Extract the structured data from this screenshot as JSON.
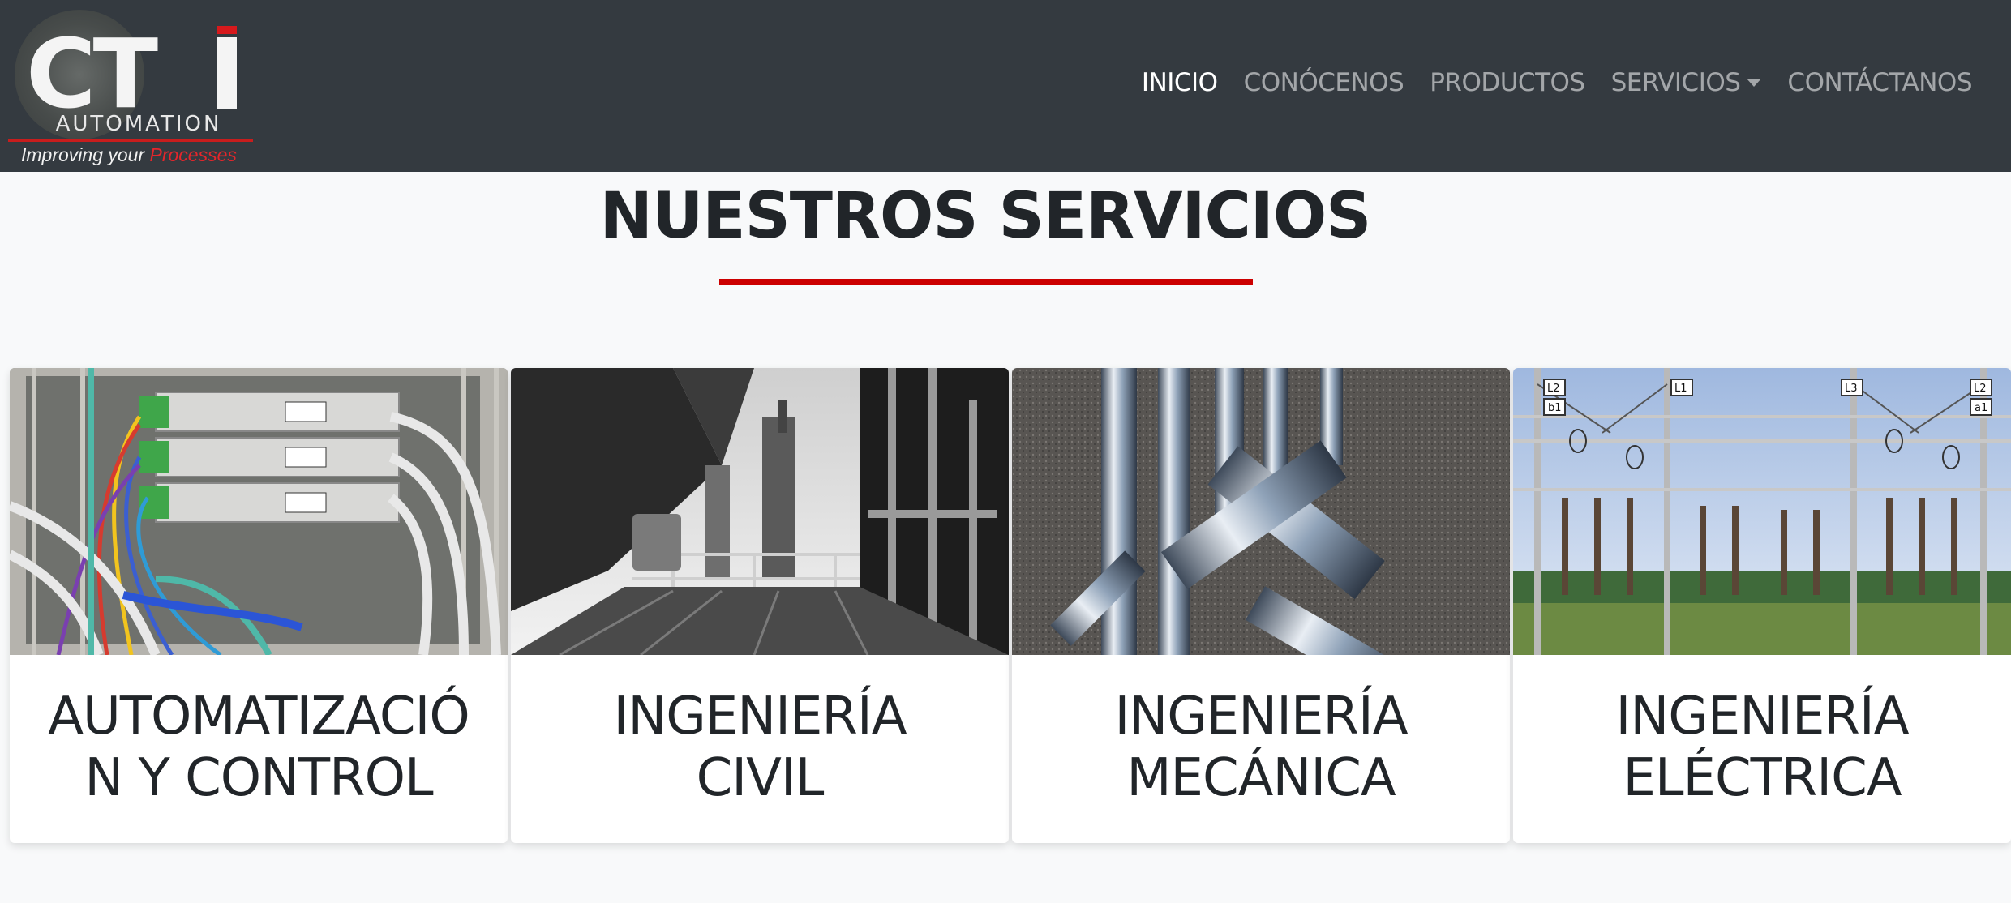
{
  "logo": {
    "letters": "CT",
    "subtitle": "AUTOMATION",
    "tagline_prefix": "Improving your ",
    "tagline_accent": "Processes"
  },
  "nav": {
    "items": [
      {
        "label": "INICIO",
        "active": true
      },
      {
        "label": "CONÓCENOS",
        "active": false
      },
      {
        "label": "PRODUCTOS",
        "active": false
      },
      {
        "label": "SERVICIOS",
        "active": false,
        "dropdown": true
      },
      {
        "label": "CONTÁCTANOS",
        "active": false
      }
    ]
  },
  "main": {
    "title": "NUESTROS SERVICIOS",
    "cards": [
      {
        "line1": "AUTOMATIZACIÓ",
        "line2": "N Y CONTROL",
        "image": "control-panel-wiring"
      },
      {
        "line1": "INGENIERÍA",
        "line2": "CIVIL",
        "image": "industrial-plant"
      },
      {
        "line1": "INGENIERÍA",
        "line2": "MECÁNICA",
        "image": "steel-pipes"
      },
      {
        "line1": "INGENIERÍA",
        "line2": "ELÉCTRICA",
        "image": "electrical-substation"
      }
    ]
  },
  "substation_labels": [
    "L2",
    "b1",
    "L1",
    "L3",
    "L2",
    "a1"
  ],
  "colors": {
    "navbar": "#343a40",
    "accent_red": "#cc0000",
    "background": "#f8f9fa"
  }
}
